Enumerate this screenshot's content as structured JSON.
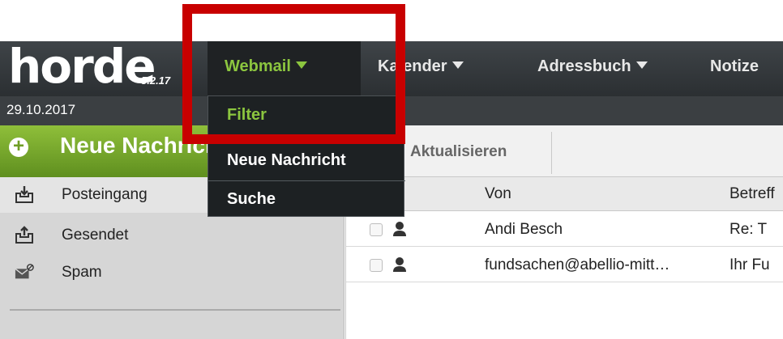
{
  "app": {
    "logo_text": "horde",
    "version": "5.2.17"
  },
  "nav": {
    "items": [
      {
        "label": "Webmail",
        "active": true
      },
      {
        "label": "Kalender",
        "active": false
      },
      {
        "label": "Adressbuch",
        "active": false
      },
      {
        "label": "Notize",
        "active": false
      }
    ]
  },
  "datebar": {
    "date": "29.10.2017"
  },
  "sidebar": {
    "compose_label": "Neue Nachricht",
    "folders": [
      {
        "label": "Posteingang",
        "icon": "inbox-icon"
      },
      {
        "label": "Gesendet",
        "icon": "outbox-icon"
      },
      {
        "label": "Spam",
        "icon": "spam-icon"
      }
    ]
  },
  "toolbar": {
    "refresh_label": "Aktualisieren"
  },
  "list": {
    "columns": {
      "from": "Von",
      "subject": "Betreff"
    },
    "rows": [
      {
        "from": "Andi Besch",
        "subject": "Re: T"
      },
      {
        "from": "fundsachen@abellio-mitt…",
        "subject": "Ihr Fu"
      }
    ]
  },
  "dropdown": {
    "items": [
      "Filter",
      "Neue Nachricht",
      "Suche"
    ]
  },
  "colors": {
    "accent_green": "#8cc63f",
    "highlight_red": "#c80000",
    "nav_dark": "#2b2f32"
  }
}
